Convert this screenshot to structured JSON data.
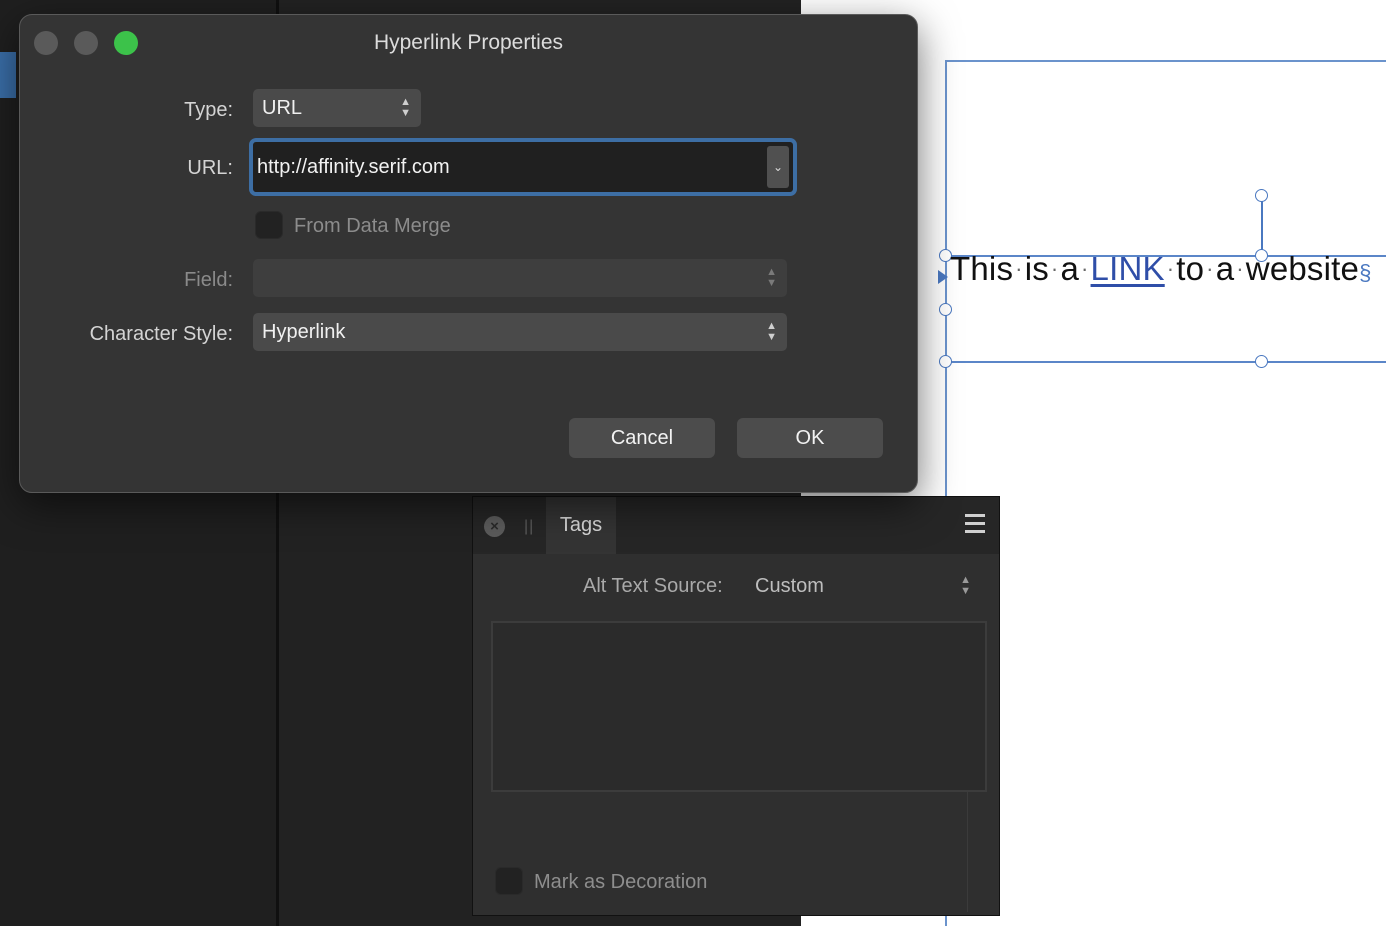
{
  "dialog": {
    "title": "Hyperlink Properties",
    "type_label": "Type:",
    "type_value": "URL",
    "url_label": "URL:",
    "url_value": "http://affinity.serif.com",
    "from_data_merge_label": "From Data Merge",
    "field_label": "Field:",
    "field_value": "",
    "character_style_label": "Character Style:",
    "character_style_value": "Hyperlink",
    "cancel_label": "Cancel",
    "ok_label": "OK"
  },
  "canvas": {
    "text_before": [
      "This",
      "is",
      "a"
    ],
    "link_text": "LINK",
    "text_after": [
      "to",
      "a",
      "website"
    ],
    "dot": "·",
    "pilcrow": "§"
  },
  "tags_panel": {
    "tab_label": "Tags",
    "alt_text_source_label": "Alt Text Source:",
    "alt_text_source_value": "Custom",
    "alt_text_value": "",
    "mark_decoration_label": "Mark as Decoration"
  },
  "icons": {
    "updown": [
      "▲",
      "▼"
    ],
    "chevron": "⌄",
    "close": "×",
    "grip": "||"
  },
  "colors": {
    "accent": "#3d6ea4",
    "zoom_green": "#3cc24a",
    "link": "#2f4ea8"
  }
}
